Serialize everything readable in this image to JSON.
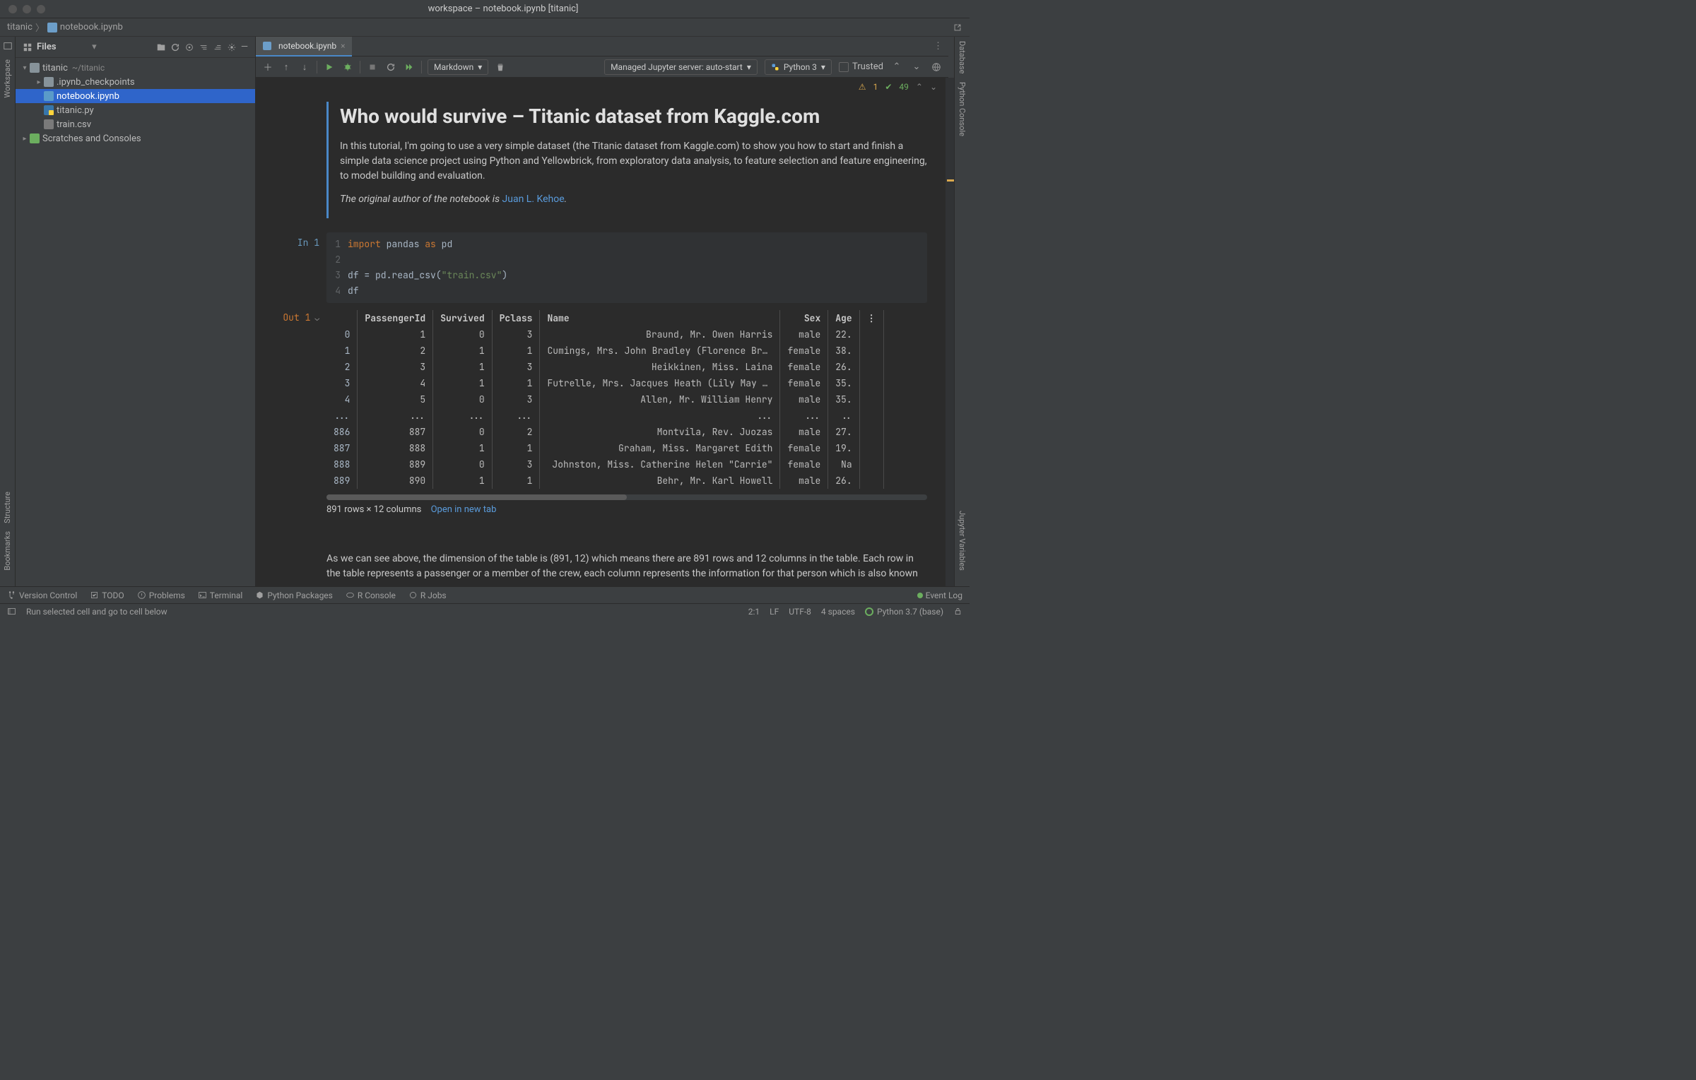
{
  "window": {
    "title": "workspace – notebook.ipynb [titanic]"
  },
  "breadcrumb": {
    "project": "titanic",
    "file": "notebook.ipynb"
  },
  "railLeft": {
    "workspace": "Workspace",
    "structure": "Structure",
    "bookmarks": "Bookmarks"
  },
  "railRight": {
    "database": "Database",
    "python": "Python Console",
    "jvars": "Jupyter Variables"
  },
  "sidebar": {
    "headerLabel": "Files",
    "root": {
      "name": "titanic",
      "path": "~/titanic"
    },
    "items": [
      {
        "name": ".ipynb_checkpoints"
      },
      {
        "name": "notebook.ipynb"
      },
      {
        "name": "titanic.py"
      },
      {
        "name": "train.csv"
      }
    ],
    "scratches": "Scratches and Consoles"
  },
  "tab": {
    "label": "notebook.ipynb"
  },
  "toolbar": {
    "cellType": "Markdown",
    "server": "Managed Jupyter server: auto-start",
    "interpreter": "Python 3",
    "trusted": "Trusted"
  },
  "inspect": {
    "warnings": "1",
    "passes": "49"
  },
  "md": {
    "title": "Who would survive – Titanic dataset from Kaggle.com",
    "p1": "In this tutorial, I'm going to use a very simple dataset (the Titanic dataset from Kaggle.com) to show you how to start and finish a simple data science project using Python and Yellowbrick, from exploratory data analysis, to feature selection and feature engineering, to model building and evaluation.",
    "p2a": "The original author of the notebook is ",
    "p2link": "Juan L. Kehoe",
    "p2b": "."
  },
  "code": {
    "promptIn": "In 1",
    "lines": [
      {
        "n": "1",
        "html": "<span class='kw'>import</span> <span class='id'>pandas</span> <span class='kw'>as</span> <span class='id'>pd</span>"
      },
      {
        "n": "2",
        "html": ""
      },
      {
        "n": "3",
        "html": "<span class='id'>df = pd.read_csv(</span><span class='str'>\"train.csv\"</span><span class='id'>)</span>"
      },
      {
        "n": "4",
        "html": "<span class='id'>df</span>"
      }
    ]
  },
  "out": {
    "promptOut": "Out 1",
    "headers": [
      "",
      "PassengerId",
      "Survived",
      "Pclass",
      "Name",
      "Sex",
      "Age"
    ],
    "rows": [
      [
        "0",
        "1",
        "0",
        "3",
        "Braund, Mr. Owen Harris",
        "male",
        "22."
      ],
      [
        "1",
        "2",
        "1",
        "1",
        "Cumings, Mrs. John Bradley (Florence Br...",
        "female",
        "38."
      ],
      [
        "2",
        "3",
        "1",
        "3",
        "Heikkinen, Miss. Laina",
        "female",
        "26."
      ],
      [
        "3",
        "4",
        "1",
        "1",
        "Futrelle, Mrs. Jacques Heath (Lily May ...",
        "female",
        "35."
      ],
      [
        "4",
        "5",
        "0",
        "3",
        "Allen, Mr. William Henry",
        "male",
        "35."
      ],
      [
        "...",
        "...",
        "...",
        "...",
        "...",
        "...",
        ".."
      ],
      [
        "886",
        "887",
        "0",
        "2",
        "Montvila, Rev. Juozas",
        "male",
        "27."
      ],
      [
        "887",
        "888",
        "1",
        "1",
        "Graham, Miss. Margaret Edith",
        "female",
        "19."
      ],
      [
        "888",
        "889",
        "0",
        "3",
        "Johnston, Miss. Catherine Helen \"Carrie\"",
        "female",
        "Na"
      ],
      [
        "889",
        "890",
        "1",
        "1",
        "Behr, Mr. Karl Howell",
        "male",
        "26."
      ]
    ],
    "meta": "891 rows × 12 columns",
    "openLink": "Open in new tab"
  },
  "md2": {
    "p": "As we can see above, the dimension of the table is (891, 12) which means there are 891 rows and 12 columns in the table. Each row in the table represents a passenger or a member of the crew, each column represents the information for that person which is also known"
  },
  "bottomTabs": {
    "vcs": "Version Control",
    "todo": "TODO",
    "problems": "Problems",
    "terminal": "Terminal",
    "pkg": "Python Packages",
    "rconsole": "R Console",
    "rjobs": "R Jobs",
    "eventlog": "Event Log"
  },
  "status": {
    "hint": "Run selected cell and go to cell below",
    "pos": "2:1",
    "eol": "LF",
    "enc": "UTF-8",
    "indent": "4 spaces",
    "py": "Python 3.7 (base)"
  }
}
